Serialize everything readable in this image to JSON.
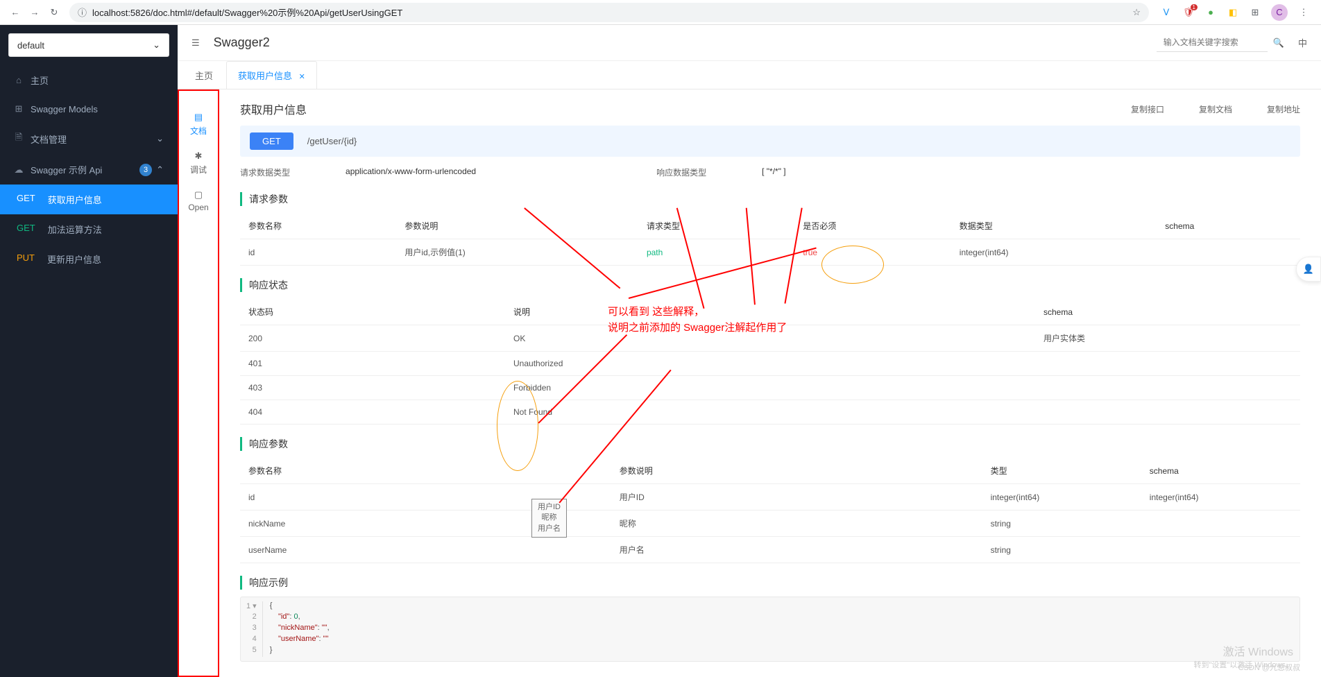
{
  "browser": {
    "url": "localhost:5826/doc.html#/default/Swagger%20示例%20Api/getUserUsingGET",
    "avatar_letter": "C"
  },
  "sidebar": {
    "dropdown": "default",
    "items": [
      {
        "icon": "⌂",
        "label": "主页"
      },
      {
        "icon": "⊞",
        "label": "Swagger Models"
      },
      {
        "icon": "🗎",
        "label": "文档管理",
        "expandable": true
      },
      {
        "icon": "☁",
        "label": "Swagger 示例 Api",
        "badge": "3",
        "expanded": true
      }
    ],
    "subs": [
      {
        "method": "GET",
        "label": "获取用户信息",
        "active": true
      },
      {
        "method": "GET",
        "label": "加法运算方法"
      },
      {
        "method": "PUT",
        "label": "更新用户信息"
      }
    ]
  },
  "topbar": {
    "title": "Swagger2",
    "search_placeholder": "输入文档关键字搜索"
  },
  "tabs": [
    {
      "label": "主页"
    },
    {
      "label": "获取用户信息",
      "closeable": true,
      "active": true
    }
  ],
  "side_actions": [
    {
      "icon": "📄",
      "label": "文档",
      "active": true
    },
    {
      "icon": "🐞",
      "label": "调试"
    },
    {
      "icon": "📋",
      "label": "Open"
    }
  ],
  "doc": {
    "title": "获取用户信息",
    "actions": [
      "复制接口",
      "复制文档",
      "复制地址"
    ],
    "method": "GET",
    "path": "/getUser/{id}",
    "req_type_label": "请求数据类型",
    "req_type": "application/x-www-form-urlencoded",
    "res_type_label": "响应数据类型",
    "res_type": "[ \"*/*\" ]"
  },
  "sections": {
    "req_params": "请求参数",
    "res_status": "响应状态",
    "res_params": "响应参数",
    "res_example": "响应示例"
  },
  "req_params": {
    "headers": [
      "参数名称",
      "参数说明",
      "请求类型",
      "是否必须",
      "数据类型",
      "schema"
    ],
    "rows": [
      {
        "name": "id",
        "desc": "用户id,示例值(1)",
        "type": "path",
        "required": "true",
        "dtype": "integer(int64)",
        "schema": ""
      }
    ]
  },
  "res_status": {
    "headers": [
      "状态码",
      "说明",
      "schema"
    ],
    "rows": [
      {
        "code": "200",
        "desc": "OK",
        "schema": "用户实体类"
      },
      {
        "code": "401",
        "desc": "Unauthorized",
        "schema": ""
      },
      {
        "code": "403",
        "desc": "Forbidden",
        "schema": ""
      },
      {
        "code": "404",
        "desc": "Not Found",
        "schema": ""
      }
    ]
  },
  "res_params": {
    "headers": [
      "参数名称",
      "参数说明",
      "类型",
      "schema"
    ],
    "rows": [
      {
        "name": "id",
        "desc": "用户ID",
        "type": "integer(int64)",
        "schema": "integer(int64)"
      },
      {
        "name": "nickName",
        "desc": "昵称",
        "type": "string",
        "schema": ""
      },
      {
        "name": "userName",
        "desc": "用户名",
        "type": "string",
        "schema": ""
      }
    ]
  },
  "example": {
    "lines": [
      "{",
      "    \"id\": 0,",
      "    \"nickName\": \"\",",
      "    \"userName\": \"\"",
      "}"
    ]
  },
  "annotations": {
    "text1": "可以看到 这些解释，",
    "text2": "说明之前添加的 Swagger注解起作用了",
    "tooltip": "用户ID\n昵称\n用户名"
  },
  "watermark": {
    "line1": "激活 Windows",
    "line2": "转到\"设置\"以激活 Windows。",
    "csdn": "CSDN @九息叔叔"
  }
}
